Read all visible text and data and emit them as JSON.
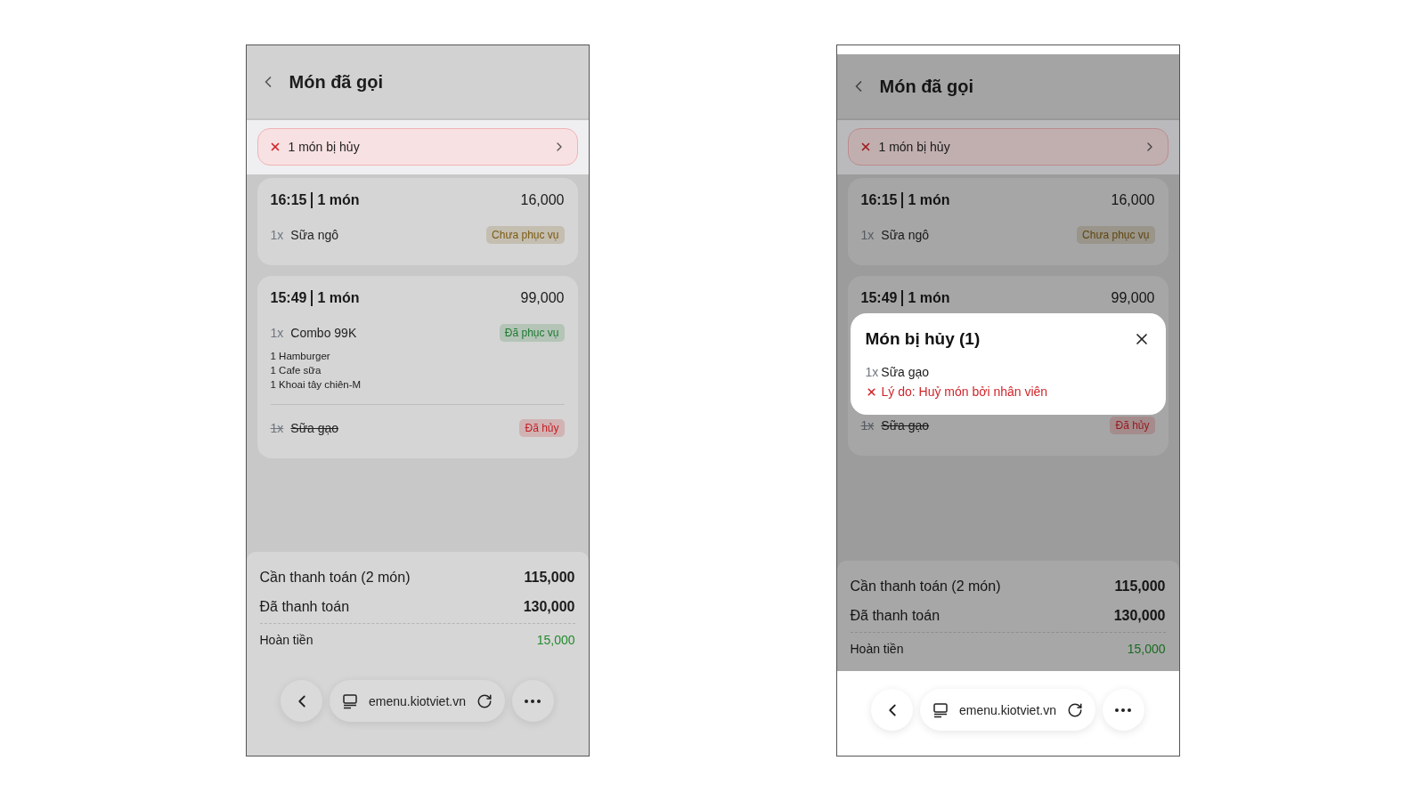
{
  "phones": [
    {
      "dimmed": false,
      "header": {
        "title": "Món đã gọi"
      },
      "cancel_banner": {
        "text": "1 món bị hủy"
      },
      "orders": [
        {
          "time": "16:15",
          "count": "1 món",
          "total": "16,000",
          "items": [
            {
              "qty": "1x",
              "name": "Sữa ngô",
              "cancelled": false,
              "badge": {
                "text": "Chưa phục vụ",
                "color": "#7a5a12"
              }
            }
          ]
        },
        {
          "time": "15:49",
          "count": "1 món",
          "total": "99,000",
          "items": [
            {
              "qty": "1x",
              "name": "Combo 99K",
              "cancelled": false,
              "badge": {
                "text": "Đã phục vụ",
                "color": "#1f7a32"
              },
              "sub_items": [
                "1 Hamburger",
                "1 Cafe sữa",
                "1 Khoai tây chiên-M"
              ]
            },
            {
              "qty": "1x",
              "name": "Sữa gạo",
              "cancelled": true,
              "badge": {
                "text": "Đã hủy",
                "color": "#c41d24"
              }
            }
          ]
        }
      ],
      "summary": [
        {
          "kind": "main",
          "label": "Cần thanh toán (2 món)",
          "value": "115,000"
        },
        {
          "kind": "main",
          "label": "Đã thanh toán",
          "value": "130,000"
        },
        {
          "kind": "refund",
          "label": "Hoàn tiền",
          "value": "15,000"
        }
      ],
      "browser_bar": {
        "url": "emenu.kiotviet.vn"
      }
    },
    {
      "dimmed": true,
      "header": {
        "title": "Món đã gọi"
      },
      "cancel_banner": {
        "text": "1 món bị hủy"
      },
      "orders": [
        {
          "time": "16:15",
          "count": "1 món",
          "total": "16,000",
          "items": [
            {
              "qty": "1x",
              "name": "Sữa ngô",
              "cancelled": false,
              "badge": {
                "text": "Chưa phục vụ",
                "color": "#5f460e"
              }
            }
          ]
        },
        {
          "time": "15:49",
          "count": "1 món",
          "total": "99,000",
          "items": [
            {
              "qty": "1x",
              "name": "Sữa gạo",
              "cancelled": true,
              "badge": {
                "text": "Đã hủy",
                "color": "#99171c"
              }
            }
          ]
        }
      ],
      "summary": [
        {
          "kind": "main",
          "label": "Cần thanh toán (2 món)",
          "value": "115,000"
        },
        {
          "kind": "main",
          "label": "Đã thanh toán",
          "value": "130,000"
        },
        {
          "kind": "refund",
          "label": "Hoàn tiền",
          "value": "15,000"
        }
      ],
      "dialog": {
        "title": "Món bị hủy (1)",
        "items": [
          {
            "qty": "1x",
            "name": "Sữa gạo",
            "reason": "Lý do: Huỷ món bởi nhân viên"
          }
        ]
      },
      "browser_bar": {
        "url": "emenu.kiotviet.vn"
      }
    }
  ]
}
